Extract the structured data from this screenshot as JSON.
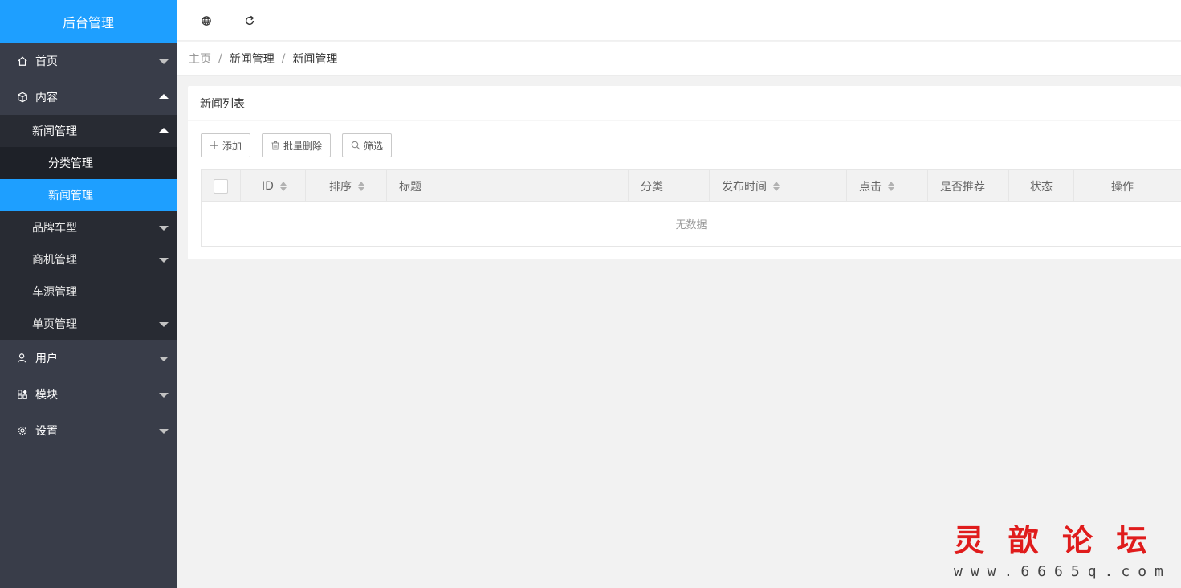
{
  "app": {
    "title": "后台管理"
  },
  "sidebar": {
    "items": [
      {
        "label": "首页",
        "icon": "home-icon"
      },
      {
        "label": "内容",
        "icon": "cube-icon"
      },
      {
        "label": "用户",
        "icon": "user-icon"
      },
      {
        "label": "模块",
        "icon": "apps-icon"
      },
      {
        "label": "设置",
        "icon": "gear-icon"
      }
    ],
    "content_sub": [
      {
        "label": "新闻管理"
      },
      {
        "label": "品牌车型"
      },
      {
        "label": "商机管理"
      },
      {
        "label": "车源管理"
      },
      {
        "label": "单页管理"
      }
    ],
    "news_sub": [
      {
        "label": "分类管理"
      },
      {
        "label": "新闻管理"
      }
    ],
    "active_color": "#1e9fff",
    "bg_color": "#393d49"
  },
  "header": {
    "icons": [
      "globe-icon",
      "refresh-icon"
    ]
  },
  "breadcrumb": {
    "items": [
      "主页",
      "新闻管理",
      "新闻管理"
    ],
    "separator": "/"
  },
  "card": {
    "title": "新闻列表",
    "toolbar": {
      "add": "添加",
      "batch_delete": "批量删除",
      "filter": "筛选"
    },
    "table": {
      "columns": [
        "ID",
        "排序",
        "标题",
        "分类",
        "发布时间",
        "点击",
        "是否推荐",
        "状态",
        "操作"
      ],
      "empty_text": "无数据"
    }
  },
  "watermark": {
    "title": [
      "灵",
      "歆",
      "论",
      "坛"
    ],
    "url": "www.6665q.com"
  }
}
